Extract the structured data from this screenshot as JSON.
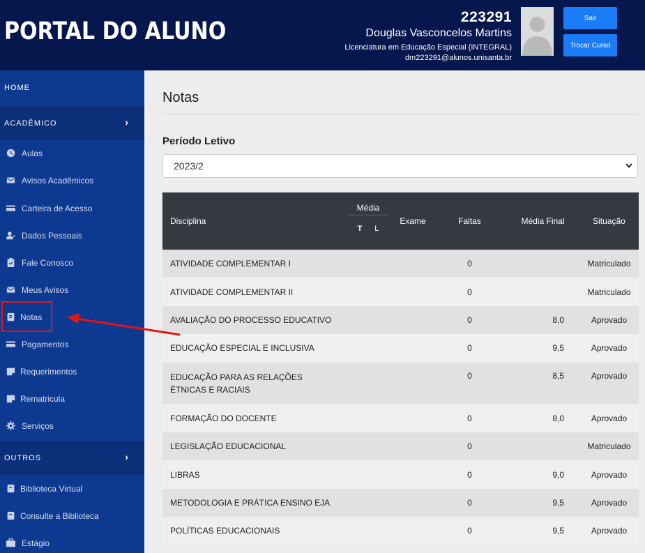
{
  "header": {
    "logo_text": "PORTAL DO ALUNO",
    "user_id": "223291",
    "user_name": "Douglas Vasconcelos Martins",
    "course": "Licenciatura em Educação Especial (INTEGRAL)",
    "email": "dm223291@alunos.unisanta.br",
    "btn_sair": "Sair",
    "btn_trocar": "Trocar Curso",
    "bg_color": "#06174d",
    "button_color": "#1b7cf7"
  },
  "sidebar": {
    "home": "HOME",
    "academico": "ACADÊMICO",
    "outros": "OUTROS",
    "academico_items": [
      {
        "label": "Aulas",
        "icon": "clock-icon"
      },
      {
        "label": "Avisos Acadêmicos",
        "icon": "envelope-icon"
      },
      {
        "label": "Carteira de Acesso",
        "icon": "card-icon"
      },
      {
        "label": "Dados Pessoais",
        "icon": "user-edit-icon"
      },
      {
        "label": "Fale Conosco",
        "icon": "clipboard-icon"
      },
      {
        "label": "Meus Avisos",
        "icon": "envelope-icon"
      },
      {
        "label": "Notas",
        "icon": "book-icon"
      },
      {
        "label": "Pagamentos",
        "icon": "card-icon"
      },
      {
        "label": "Requerimentos",
        "icon": "note-icon"
      },
      {
        "label": "Rematricula",
        "icon": "note-icon"
      },
      {
        "label": "Serviços",
        "icon": "gear-icon"
      }
    ],
    "outros_items": [
      {
        "label": "Biblioteca Virtual",
        "icon": "book-icon"
      },
      {
        "label": "Consulte a Biblioteca",
        "icon": "book-icon"
      },
      {
        "label": "Estágio",
        "icon": "briefcase-icon"
      }
    ],
    "bg_color": "#0d3a90"
  },
  "main": {
    "title": "Notas",
    "period_label": "Período Letivo",
    "period_value": "2023/2",
    "table": {
      "headers": {
        "disciplina": "Disciplina",
        "media": "Média",
        "media_t": "T",
        "media_l": "L",
        "exame": "Exame",
        "faltas": "Faltas",
        "media_final": "Média Final",
        "situacao": "Situação"
      },
      "rows": [
        {
          "disciplina": "ATIVIDADE COMPLEMENTAR I",
          "faltas": "0",
          "media_final": "",
          "situacao": "Matriculado"
        },
        {
          "disciplina": "ATIVIDADE COMPLEMENTAR II",
          "faltas": "0",
          "media_final": "",
          "situacao": "Matriculado"
        },
        {
          "disciplina": "AVALIAÇÃO DO PROCESSO EDUCATIVO",
          "faltas": "0",
          "media_final": "8,0",
          "situacao": "Aprovado"
        },
        {
          "disciplina": "EDUCAÇÃO ESPECIAL E INCLUSIVA",
          "faltas": "0",
          "media_final": "9,5",
          "situacao": "Aprovado"
        },
        {
          "disciplina": "EDUCAÇÃO PARA AS RELAÇÕES ÉTNICAS E RACIAIS",
          "faltas": "0",
          "media_final": "8,5",
          "situacao": "Aprovado"
        },
        {
          "disciplina": "FORMAÇÃO DO DOCENTE",
          "faltas": "0",
          "media_final": "8,0",
          "situacao": "Aprovado"
        },
        {
          "disciplina": "LEGISLAÇÃO EDUCACIONAL",
          "faltas": "0",
          "media_final": "",
          "situacao": "Matriculado"
        },
        {
          "disciplina": "LIBRAS",
          "faltas": "0",
          "media_final": "9,0",
          "situacao": "Aprovado"
        },
        {
          "disciplina": "METODOLOGIA E PRÁTICA ENSINO EJA",
          "faltas": "0",
          "media_final": "9,5",
          "situacao": "Aprovado"
        },
        {
          "disciplina": "POLÍTICAS EDUCACIONAIS",
          "faltas": "0",
          "media_final": "9,5",
          "situacao": "Aprovado"
        }
      ]
    }
  },
  "annotation": {
    "color": "#e41515"
  }
}
